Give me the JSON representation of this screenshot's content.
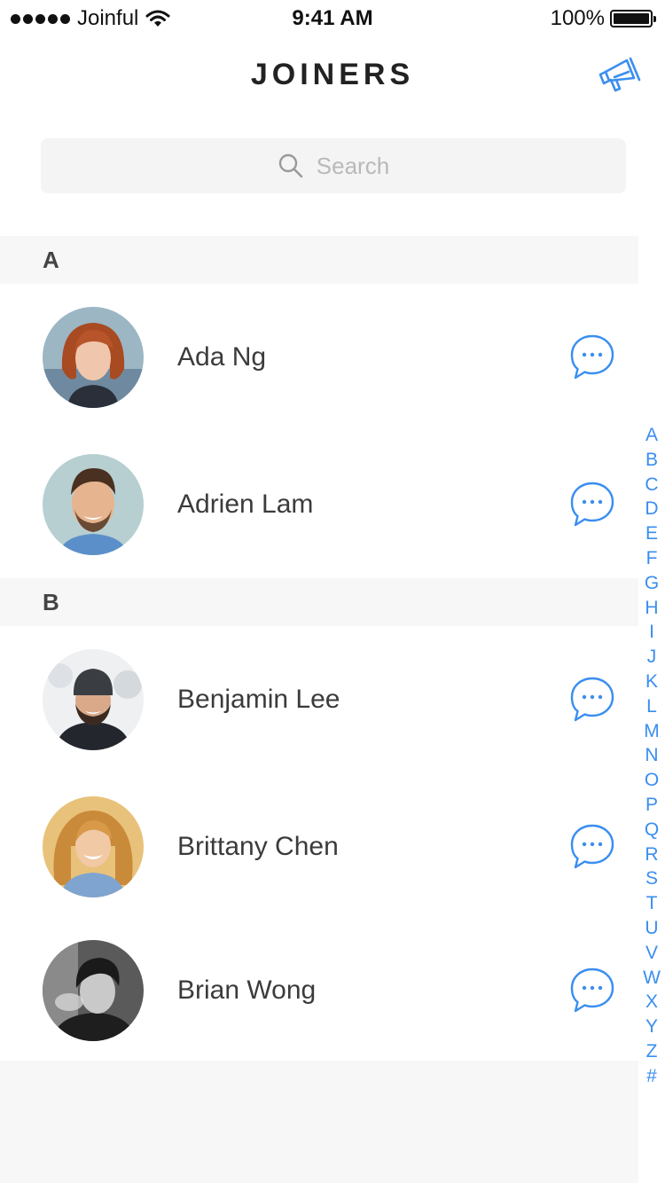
{
  "status_bar": {
    "carrier": "Joinful",
    "time": "9:41 AM",
    "battery": "100%"
  },
  "nav": {
    "title": "JOINERS",
    "right_icon": "megaphone-icon"
  },
  "search": {
    "placeholder": "Search",
    "icon": "search-icon"
  },
  "sections": [
    {
      "letter": "A",
      "contacts": [
        {
          "name": "Ada Ng"
        },
        {
          "name": "Adrien Lam"
        }
      ]
    },
    {
      "letter": "B",
      "contacts": [
        {
          "name": "Benjamin Lee"
        },
        {
          "name": "Brittany Chen"
        },
        {
          "name": "Brian Wong"
        }
      ]
    }
  ],
  "index": [
    "A",
    "B",
    "C",
    "D",
    "E",
    "F",
    "G",
    "H",
    "I",
    "J",
    "K",
    "L",
    "M",
    "N",
    "O",
    "P",
    "Q",
    "R",
    "S",
    "T",
    "U",
    "V",
    "W",
    "X",
    "Y",
    "Z",
    "#"
  ],
  "colors": {
    "accent": "#3a8ef0",
    "section_bg": "#f7f7f7",
    "search_bg": "#f4f4f4"
  }
}
